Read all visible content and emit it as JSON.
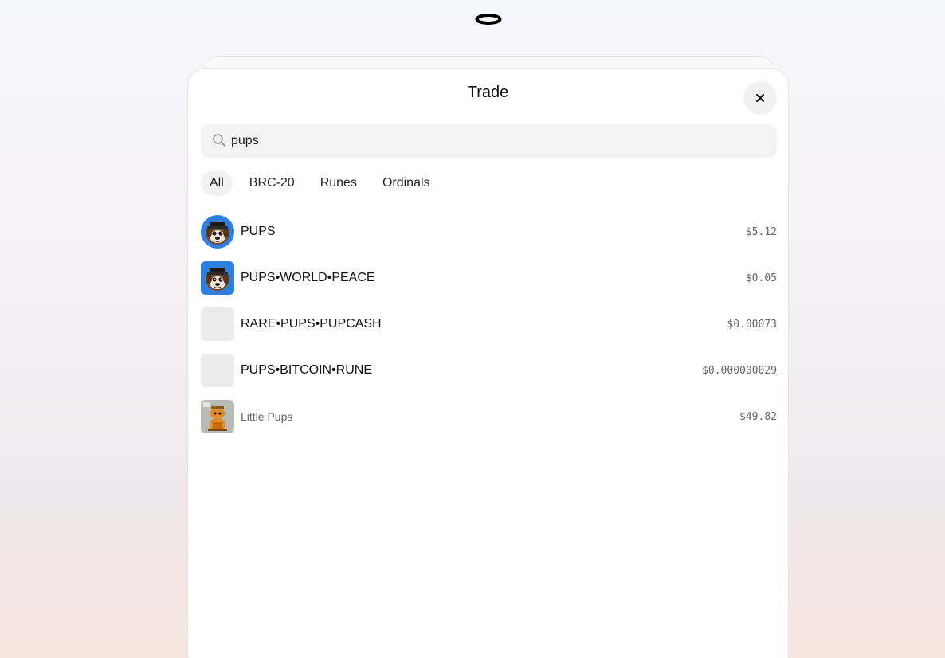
{
  "header": {
    "logo_icon": "oval-ring-logo"
  },
  "modal": {
    "title": "Trade",
    "close_icon": "close-icon"
  },
  "search": {
    "value": "pups",
    "icon": "search-icon"
  },
  "tabs": [
    {
      "label": "All",
      "active": true
    },
    {
      "label": "BRC-20",
      "active": false
    },
    {
      "label": "Runes",
      "active": false
    },
    {
      "label": "Ordinals",
      "active": false
    }
  ],
  "results": [
    {
      "name": "PUPS",
      "price": "$5.12",
      "avatar": "pups-dog-avatar"
    },
    {
      "name": "PUPS•WORLD•PEACE",
      "price": "$0.05",
      "avatar": "pups-dog-avatar"
    },
    {
      "name": "RARE•PUPS•PUPCASH",
      "price": "$0.00073",
      "avatar": "placeholder"
    },
    {
      "name": "PUPS•BITCOIN•RUNE",
      "price": "$0.000000029",
      "avatar": "placeholder"
    },
    {
      "name": "Little Pups",
      "price": "$49.82",
      "avatar": "little-pups-avatar"
    }
  ],
  "colors": {
    "pups_avatar_blue": "#2f7fe0",
    "placeholder_gray": "#ececec"
  }
}
